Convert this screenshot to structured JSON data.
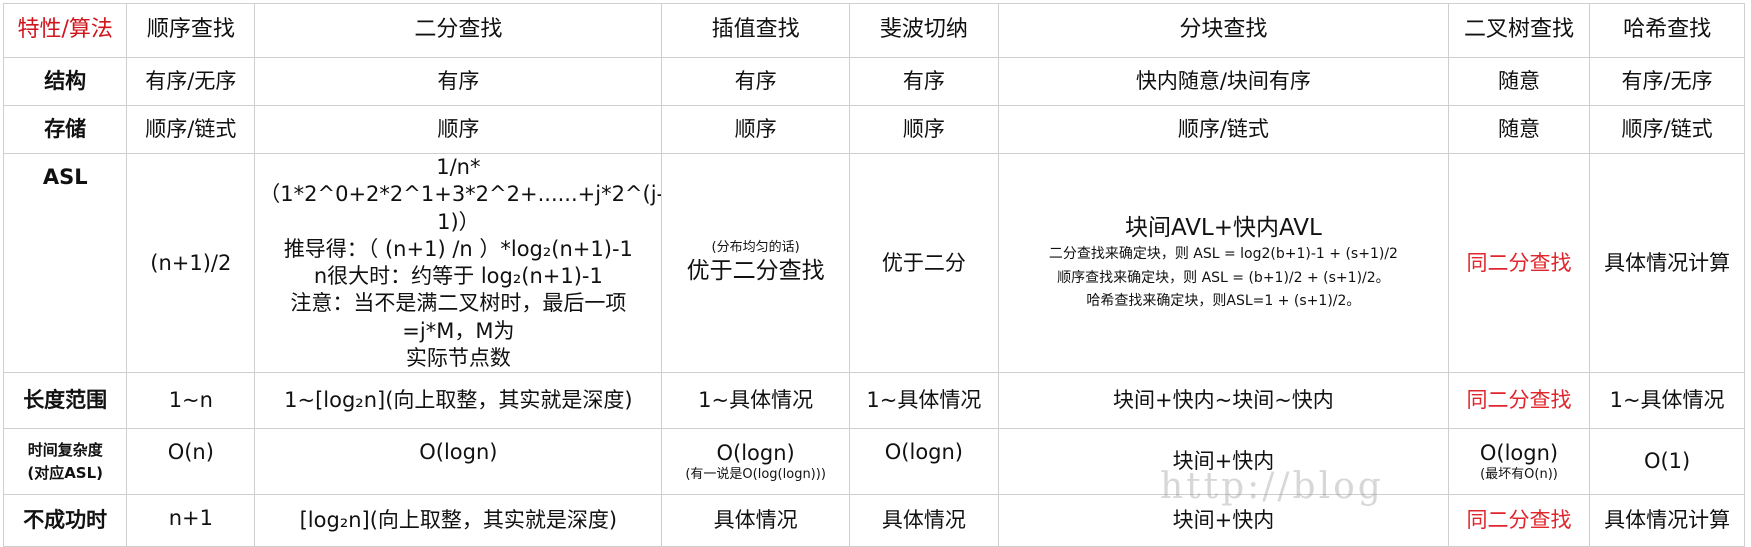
{
  "header": {
    "corner": "特性/算法",
    "algos": [
      "顺序查找",
      "二分查找",
      "插值查找",
      "斐波切纳",
      "分块查找",
      "二叉树查找",
      "哈希查找"
    ]
  },
  "structure": {
    "label": "结构",
    "values": [
      "有序/无序",
      "有序",
      "有序",
      "有序",
      "快内随意/块间有序",
      "随意",
      "有序/无序"
    ]
  },
  "storage": {
    "label": "存储",
    "values": [
      "顺序/链式",
      "顺序",
      "顺序",
      "顺序",
      "顺序/链式",
      "随意",
      "顺序/链式"
    ]
  },
  "asl": {
    "label": "ASL",
    "sequential": "(n+1)/2",
    "binary_lines": [
      "1/n* （1*2^0+2*2^1+3*2^2+......+j*2^(j-1)）",
      "推导得：（ (n+1) /n ）*log₂(n+1)-1",
      "n很大时：约等于 log₂(n+1)-1",
      "注意：当不是满二叉树时，最后一项=j*M，M为",
      "实际节点数"
    ],
    "interpolation_note": "(分布均匀的话)",
    "interpolation": "优于二分查找",
    "fibonacci": "优于二分",
    "block_title": "块间AVL+快内AVL",
    "block_lines": [
      "二分查找来确定块，则 ASL = log2(b+1)-1 + (s+1)/2",
      "顺序查找来确定块，则 ASL = (b+1)/2 + (s+1)/2。",
      "哈希查找来确定块，则ASL=1 + (s+1)/2。"
    ],
    "tree": "同二分查找",
    "hash": "具体情况计算"
  },
  "length_range": {
    "label": "长度范围",
    "values": [
      "1~n",
      "1~[log₂n](向上取整，其实就是深度)",
      "1~具体情况",
      "1~具体情况",
      "块间+快内~块间~快内",
      "同二分查找",
      "1~具体情况"
    ]
  },
  "time_complexity": {
    "label_line1": "时间复杂度",
    "label_line2": "(对应ASL)",
    "sequential": "O(n)",
    "binary": "O(logn)",
    "interpolation": "O(logn)",
    "interpolation_note": "(有一说是O(log(logn)))",
    "fibonacci": "O(logn)",
    "block": "块间+快内",
    "tree": "O(logn)",
    "tree_note": "(最坏有O(n))",
    "hash": "O(1)"
  },
  "failure": {
    "label": "不成功时",
    "values": [
      "n+1",
      "[log₂n](向上取整，其实就是深度)",
      "具体情况",
      "具体情况",
      "块间+快内",
      "同二分查找",
      "具体情况计算"
    ]
  },
  "watermark": "http://blog",
  "colors": {
    "accent_red": "#e0262c",
    "grid": "#cfcfcf"
  }
}
